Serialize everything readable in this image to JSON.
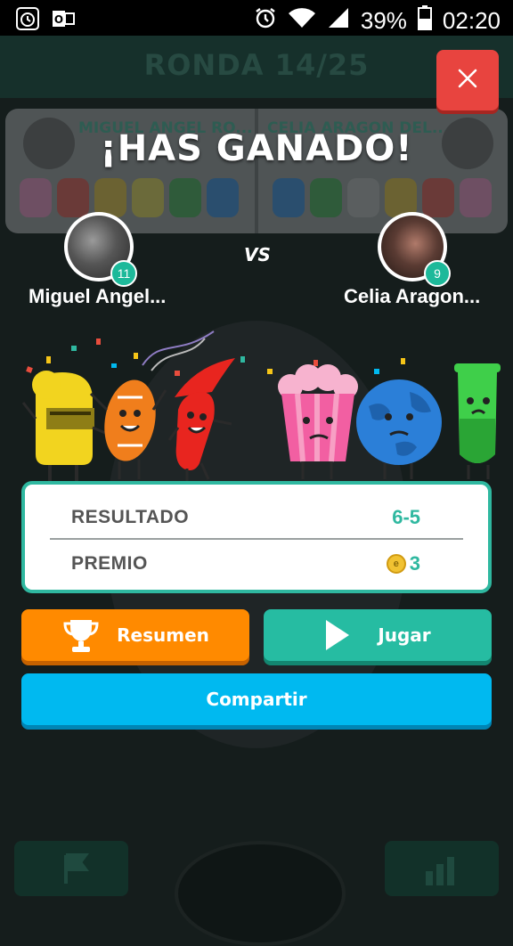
{
  "status_bar": {
    "battery_percent": "39%",
    "time": "02:20",
    "icons": [
      "alarm-app-icon",
      "outlook-icon",
      "alarm-clock-icon",
      "wifi-icon",
      "signal-icon",
      "battery-icon"
    ]
  },
  "background": {
    "round_label": "RONDA 14/25",
    "left_name": "MIGUEL ANGEL RO...",
    "right_name": "CELIA ARAGON DEL..."
  },
  "dialog": {
    "title": "¡HAS GANADO!",
    "vs_label": "VS",
    "player1": {
      "name": "Miguel Angel...",
      "level": "11"
    },
    "player2": {
      "name": "Celia Aragon...",
      "level": "9"
    },
    "result_label": "RESULTADO",
    "result_value": "6-5",
    "prize_label": "PREMIO",
    "prize_value": "3",
    "buttons": {
      "resumen": "Resumen",
      "jugar": "Jugar",
      "compartir": "Compartir"
    }
  },
  "colors": {
    "accent_teal": "#2fb8a0",
    "orange": "#ff8a00",
    "blue": "#00b9f0",
    "red_close": "#e8443f"
  }
}
